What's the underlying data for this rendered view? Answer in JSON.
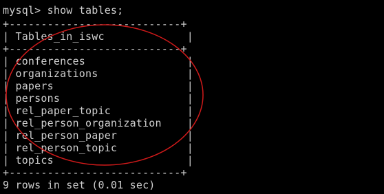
{
  "terminal": {
    "prompt_line": "mysql> show tables;",
    "border_top": "+---------------------------+",
    "header": "| Tables_in_iswc             |",
    "border_mid": "+---------------------------+",
    "rows": [
      "| conferences                |",
      "| organizations              |",
      "| papers                     |",
      "| persons                    |",
      "| rel_paper_topic            |",
      "| rel_person_organization    |",
      "| rel_person_paper           |",
      "| rel_person_topic           |",
      "| topics                     |"
    ],
    "border_bottom": "+---------------------------+",
    "footer": "9 rows in set (0.01 sec)"
  },
  "colors": {
    "background": "#000000",
    "text": "#cfcfcf",
    "annotation": "#d11a1a"
  }
}
